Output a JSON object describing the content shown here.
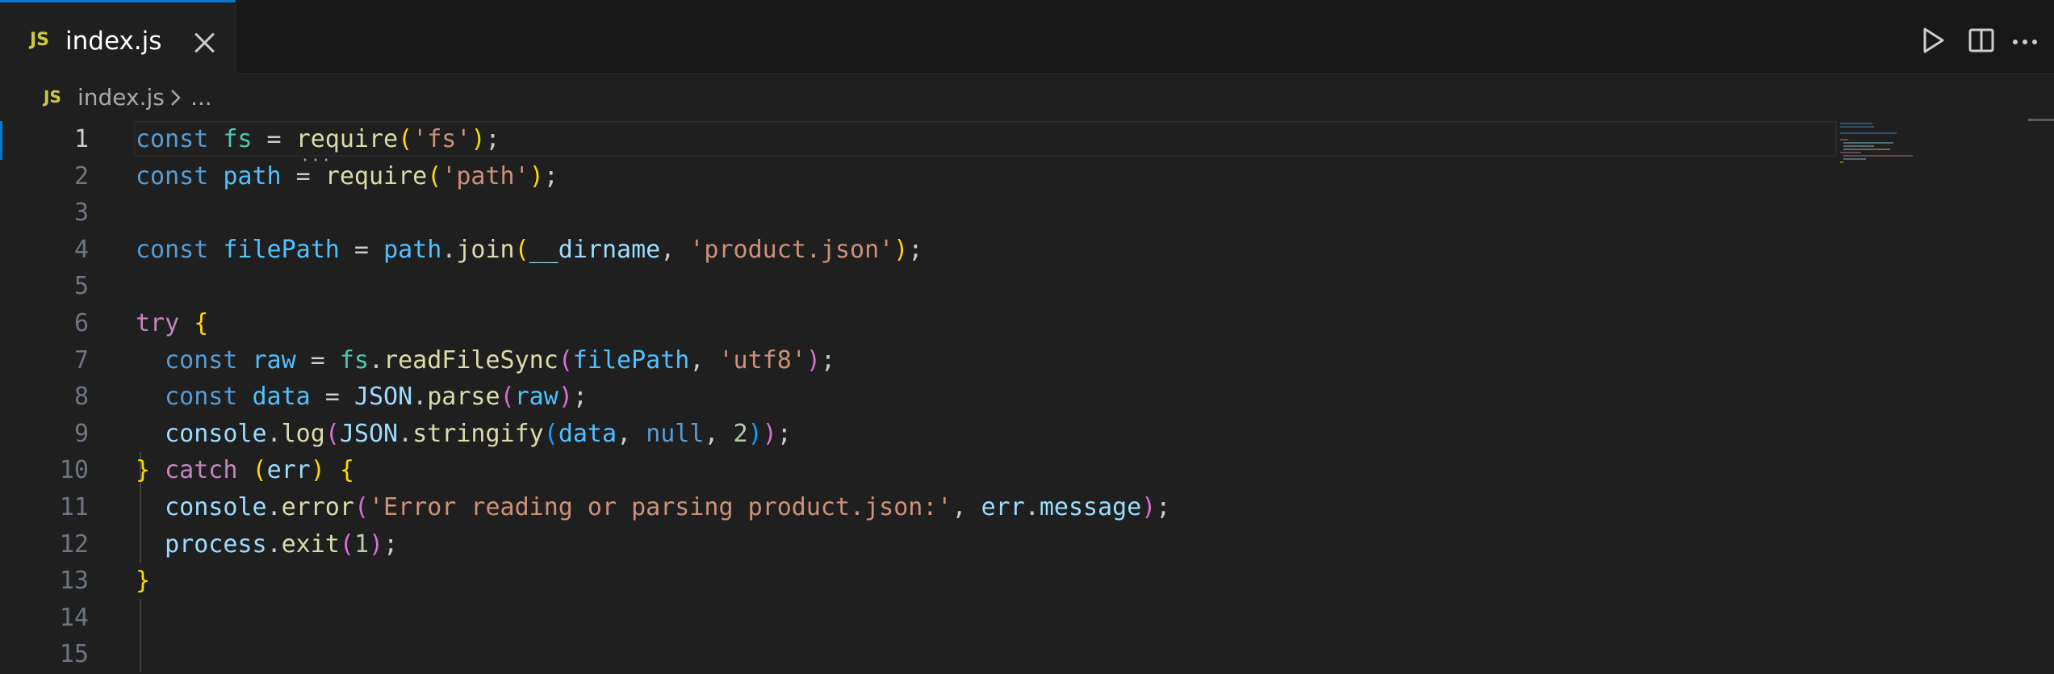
{
  "tab": {
    "icon": "JS",
    "label": "index.js"
  },
  "actions": {
    "run": "run-icon",
    "split": "split-editor-icon",
    "more": "more-actions-icon"
  },
  "breadcrumb": {
    "icon": "JS",
    "file": "index.js",
    "ellipsis": "..."
  },
  "editor": {
    "active_line": 1,
    "line_numbers": [
      "1",
      "2",
      "3",
      "4",
      "5",
      "6",
      "7",
      "8",
      "9",
      "10",
      "11",
      "12",
      "13",
      "14",
      "15"
    ],
    "lines": [
      [
        {
          "t": "const",
          "c": "kw"
        },
        {
          "t": " ",
          "c": "pl"
        },
        {
          "t": "fs",
          "c": "typ"
        },
        {
          "t": " = ",
          "c": "pl"
        },
        {
          "t": "require",
          "c": "fn"
        },
        {
          "t": "(",
          "c": "b1"
        },
        {
          "t": "'fs'",
          "c": "str"
        },
        {
          "t": ")",
          "c": "b1"
        },
        {
          "t": ";",
          "c": "pl"
        }
      ],
      [
        {
          "t": "const",
          "c": "kw"
        },
        {
          "t": " ",
          "c": "pl"
        },
        {
          "t": "path",
          "c": "cst"
        },
        {
          "t": " = ",
          "c": "pl"
        },
        {
          "t": "require",
          "c": "fn"
        },
        {
          "t": "(",
          "c": "b1"
        },
        {
          "t": "'path'",
          "c": "str"
        },
        {
          "t": ")",
          "c": "b1"
        },
        {
          "t": ";",
          "c": "pl"
        }
      ],
      [],
      [
        {
          "t": "const",
          "c": "kw"
        },
        {
          "t": " ",
          "c": "pl"
        },
        {
          "t": "filePath",
          "c": "cst"
        },
        {
          "t": " = ",
          "c": "pl"
        },
        {
          "t": "path",
          "c": "cst"
        },
        {
          "t": ".",
          "c": "pl"
        },
        {
          "t": "join",
          "c": "fn"
        },
        {
          "t": "(",
          "c": "b1"
        },
        {
          "t": "__dirname",
          "c": "var"
        },
        {
          "t": ", ",
          "c": "pl"
        },
        {
          "t": "'product.json'",
          "c": "str"
        },
        {
          "t": ")",
          "c": "b1"
        },
        {
          "t": ";",
          "c": "pl"
        }
      ],
      [],
      [
        {
          "t": "try",
          "c": "ctl"
        },
        {
          "t": " ",
          "c": "pl"
        },
        {
          "t": "{",
          "c": "b1"
        }
      ],
      [
        {
          "t": "  ",
          "c": "pl"
        },
        {
          "t": "const",
          "c": "kw"
        },
        {
          "t": " ",
          "c": "pl"
        },
        {
          "t": "raw",
          "c": "cst"
        },
        {
          "t": " = ",
          "c": "pl"
        },
        {
          "t": "fs",
          "c": "typ"
        },
        {
          "t": ".",
          "c": "pl"
        },
        {
          "t": "readFileSync",
          "c": "fn"
        },
        {
          "t": "(",
          "c": "b2"
        },
        {
          "t": "filePath",
          "c": "cst"
        },
        {
          "t": ", ",
          "c": "pl"
        },
        {
          "t": "'utf8'",
          "c": "str"
        },
        {
          "t": ")",
          "c": "b2"
        },
        {
          "t": ";",
          "c": "pl"
        }
      ],
      [
        {
          "t": "  ",
          "c": "pl"
        },
        {
          "t": "const",
          "c": "kw"
        },
        {
          "t": " ",
          "c": "pl"
        },
        {
          "t": "data",
          "c": "cst"
        },
        {
          "t": " = ",
          "c": "pl"
        },
        {
          "t": "JSON",
          "c": "var"
        },
        {
          "t": ".",
          "c": "pl"
        },
        {
          "t": "parse",
          "c": "fn"
        },
        {
          "t": "(",
          "c": "b2"
        },
        {
          "t": "raw",
          "c": "cst"
        },
        {
          "t": ")",
          "c": "b2"
        },
        {
          "t": ";",
          "c": "pl"
        }
      ],
      [
        {
          "t": "  ",
          "c": "pl"
        },
        {
          "t": "console",
          "c": "var"
        },
        {
          "t": ".",
          "c": "pl"
        },
        {
          "t": "log",
          "c": "fn"
        },
        {
          "t": "(",
          "c": "b2"
        },
        {
          "t": "JSON",
          "c": "var"
        },
        {
          "t": ".",
          "c": "pl"
        },
        {
          "t": "stringify",
          "c": "fn"
        },
        {
          "t": "(",
          "c": "b3"
        },
        {
          "t": "data",
          "c": "cst"
        },
        {
          "t": ", ",
          "c": "pl"
        },
        {
          "t": "null",
          "c": "kw"
        },
        {
          "t": ", ",
          "c": "pl"
        },
        {
          "t": "2",
          "c": "num"
        },
        {
          "t": ")",
          "c": "b3"
        },
        {
          "t": ")",
          "c": "b2"
        },
        {
          "t": ";",
          "c": "pl"
        }
      ],
      [
        {
          "t": "}",
          "c": "b1"
        },
        {
          "t": " ",
          "c": "pl"
        },
        {
          "t": "catch",
          "c": "ctl"
        },
        {
          "t": " ",
          "c": "pl"
        },
        {
          "t": "(",
          "c": "b1"
        },
        {
          "t": "err",
          "c": "var"
        },
        {
          "t": ")",
          "c": "b1"
        },
        {
          "t": " ",
          "c": "pl"
        },
        {
          "t": "{",
          "c": "b1"
        }
      ],
      [
        {
          "t": "  ",
          "c": "pl"
        },
        {
          "t": "console",
          "c": "var"
        },
        {
          "t": ".",
          "c": "pl"
        },
        {
          "t": "error",
          "c": "fn"
        },
        {
          "t": "(",
          "c": "b2"
        },
        {
          "t": "'Error reading or parsing product.json:'",
          "c": "str"
        },
        {
          "t": ", ",
          "c": "pl"
        },
        {
          "t": "err",
          "c": "var"
        },
        {
          "t": ".",
          "c": "pl"
        },
        {
          "t": "message",
          "c": "var"
        },
        {
          "t": ")",
          "c": "b2"
        },
        {
          "t": ";",
          "c": "pl"
        }
      ],
      [
        {
          "t": "  ",
          "c": "pl"
        },
        {
          "t": "process",
          "c": "var"
        },
        {
          "t": ".",
          "c": "pl"
        },
        {
          "t": "exit",
          "c": "fn"
        },
        {
          "t": "(",
          "c": "b2"
        },
        {
          "t": "1",
          "c": "num"
        },
        {
          "t": ")",
          "c": "b2"
        },
        {
          "t": ";",
          "c": "pl"
        }
      ],
      [
        {
          "t": "}",
          "c": "b1"
        }
      ],
      [],
      []
    ]
  },
  "colors": {
    "accent": "#0078d4",
    "background": "#1f1f1f",
    "tabbar": "#181818",
    "js_icon": "#cbcb41"
  }
}
